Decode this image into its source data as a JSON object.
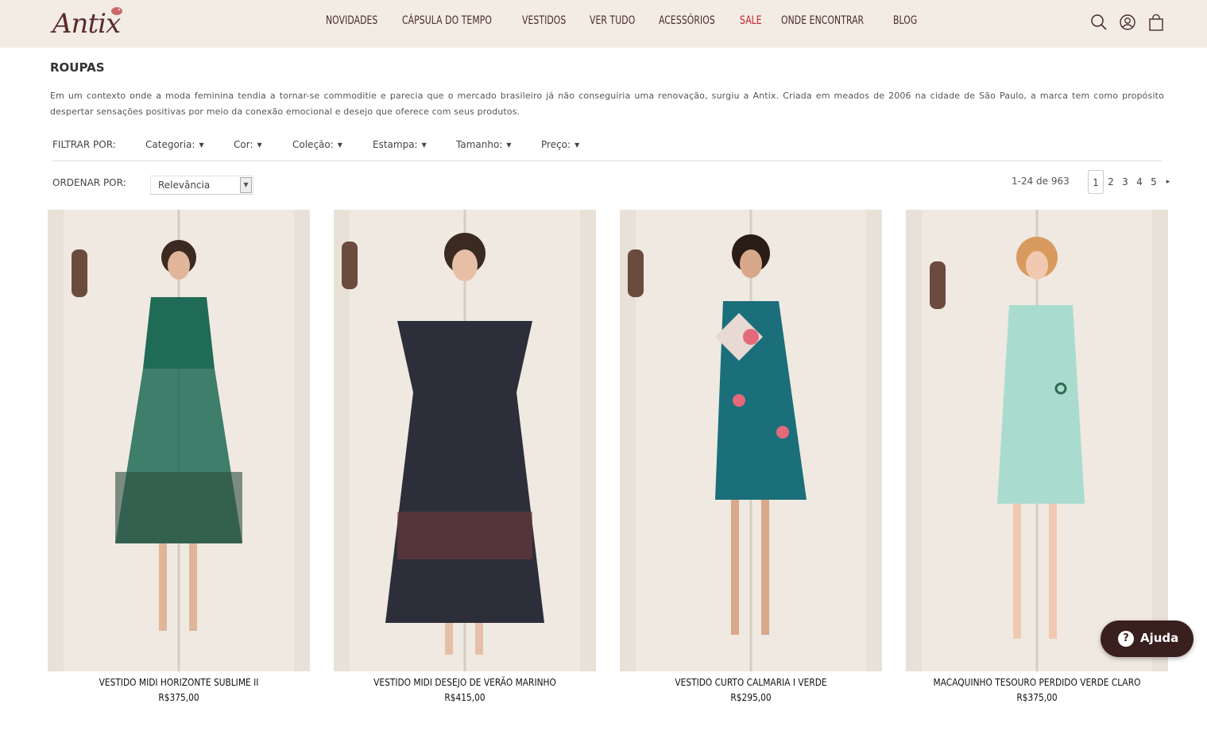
{
  "brand": {
    "logo_text": "Antix"
  },
  "nav": [
    {
      "label": "NOVIDADES",
      "highlight": false
    },
    {
      "label": "CÁPSULA DO TEMPO",
      "highlight": false
    },
    {
      "label": "VESTIDOS",
      "highlight": false
    },
    {
      "label": "VER TUDO",
      "highlight": false
    },
    {
      "label": "ACESSÓRIOS",
      "highlight": false
    },
    {
      "label": "SALE",
      "highlight": true
    },
    {
      "label": "ONDE ENCONTRAR",
      "highlight": false
    },
    {
      "label": "BLOG",
      "highlight": false
    }
  ],
  "header_icons": [
    "search-icon",
    "user-icon",
    "bag-icon"
  ],
  "colors": {
    "topbar_bg": "#f2ece4",
    "nav_text": "#4a2a2a",
    "sale": "#c8202a",
    "help_bg": "#3a1f1f"
  },
  "page": {
    "title": "ROUPAS",
    "description": "Em um contexto onde a moda feminina tendia a tornar-se commoditie e parecia que o mercado brasileiro já não conseguiria uma renovação, surgiu a Antix. Criada em meados de 2006 na cidade de São Paulo, a marca tem como propósito despertar sensações positivas por meio da conexão emocional e desejo que oferece com seus produtos."
  },
  "filters": {
    "label": "FILTRAR POR:",
    "items": [
      "Categoria:",
      "Cor:",
      "Coleção:",
      "Estampa:",
      "Tamanho:",
      "Preço:"
    ]
  },
  "sort": {
    "label": "ORDENAR POR:",
    "selected": "Relevância"
  },
  "pagination": {
    "count": "1-24 de 963",
    "pages": [
      "1",
      "2",
      "3",
      "4",
      "5"
    ],
    "current": "1",
    "next": "▸"
  },
  "products": [
    {
      "name": "VESTIDO MIDI HORIZONTE SUBLIME II",
      "price": "R$375,00",
      "dress_color": "#1f6b55"
    },
    {
      "name": "VESTIDO MIDI DESEJO DE VERÃO MARINHO",
      "price": "R$415,00",
      "dress_color": "#2c2f3a"
    },
    {
      "name": "VESTIDO CURTO CALMARIA I VERDE",
      "price": "R$295,00",
      "dress_color": "#1a6f7a"
    },
    {
      "name": "MACAQUINHO TESOURO PERDIDO VERDE CLARO",
      "price": "R$375,00",
      "dress_color": "#a9dccf"
    }
  ],
  "help": {
    "icon": "?",
    "label": "Ajuda"
  }
}
